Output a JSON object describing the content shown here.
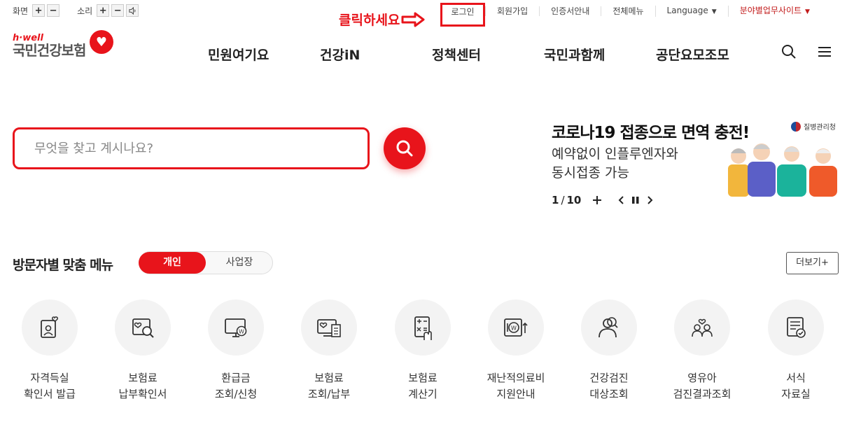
{
  "util_left": {
    "screen_label": "화면",
    "sound_label": "소리",
    "plus": "+",
    "minus": "−"
  },
  "util_right": {
    "login": "로그인",
    "signup": "회원가입",
    "cert": "인증서안내",
    "allmenu": "전체메뉴",
    "language": "Language",
    "field_sites": "분야별업무사이트"
  },
  "annotation": "클릭하세요",
  "logo": {
    "hwell": "h·well",
    "name": "국민건강보험"
  },
  "gnb": [
    "민원여기요",
    "건강iN",
    "정책센터",
    "국민과함께",
    "공단요모조모"
  ],
  "search": {
    "placeholder": "무엇을 찾고 계시나요?"
  },
  "banner": {
    "title": "코로나19 접종으로 면역 충전!",
    "sub1": "예약없이 인플루엔자와",
    "sub2": "동시접종 가능",
    "agency": "질병관리청",
    "current": "1",
    "total": "10",
    "sep": "/"
  },
  "visitor_menu": {
    "title": "방문자별 맞춤 메뉴",
    "tab_personal": "개인",
    "tab_business": "사업장",
    "more": "더보기+",
    "items": [
      {
        "icon": "id-card-heart-icon",
        "line1": "자격득실",
        "line2": "확인서 발급"
      },
      {
        "icon": "heart-search-icon",
        "line1": "보험료",
        "line2": "납부확인서"
      },
      {
        "icon": "monitor-won-icon",
        "line1": "환급금",
        "line2": "조회/신청"
      },
      {
        "icon": "monitor-document-icon",
        "line1": "보험료",
        "line2": "조회/납부"
      },
      {
        "icon": "calculator-hand-icon",
        "line1": "보험료",
        "line2": "계산기"
      },
      {
        "icon": "safe-won-icon",
        "line1": "재난적의료비",
        "line2": "지원안내"
      },
      {
        "icon": "person-search-icon",
        "line1": "건강검진",
        "line2": "대상조회"
      },
      {
        "icon": "family-heart-icon",
        "line1": "영유아",
        "line2": "검진결과조회"
      },
      {
        "icon": "document-check-icon",
        "line1": "서식",
        "line2": "자료실"
      }
    ]
  },
  "colors": {
    "accent": "#e8141b"
  }
}
